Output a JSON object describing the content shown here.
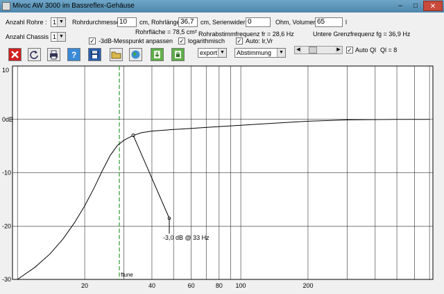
{
  "window": {
    "title": "Mivoc AW 3000 im Bassreflex-Gehäuse",
    "min": "–",
    "max": "□",
    "close": "✕"
  },
  "row1": {
    "anzahl_rohre_label": "Anzahl Rohre :",
    "anzahl_rohre_value": "1",
    "rohrdurchmesser_label": "Rohrdurchmesser",
    "rohrdurchmesser_value": "10",
    "rohrlaenge_label": "cm, Rohrlänge",
    "rohrlaenge_value": "36,7",
    "serienwiderstand_label": "cm, Serienwiderstand",
    "serienwiderstand_value": "0",
    "volumen_label": "Ohm, Volumen",
    "volumen_value": "65",
    "volumen_unit": "l"
  },
  "row2": {
    "rohrflaeche": "Rohrfläche = 78,5 cm²",
    "abstimmfrequenz": "Rohrabstimmfrequenz fr = 28,6 Hz",
    "grenzfrequenz": "Untere Grenzfrequenz fg = 36,9 Hz",
    "anzahl_chassis_label": "Anzahl Chassis :",
    "anzahl_chassis_value": "1",
    "messpunkt_label": "-3dB-Messpunkt anpassen",
    "logarithmisch_label": "logarithmisch",
    "auto_lr_label": "Auto: lr,Vr"
  },
  "toolbar": {
    "export_value": "export",
    "abstimmung_value": "Abstimmung",
    "auto_ql_label": "Auto Ql",
    "ql_value": "Ql = 8"
  },
  "colors": {
    "curve": "#000000",
    "marker": "#2f9a2f",
    "grid": "#000000"
  },
  "chart_data": {
    "type": "line",
    "title": "",
    "xlabel": "",
    "ylabel": "",
    "x_scale": "log",
    "x_ticks": [
      20,
      40,
      60,
      80,
      100,
      200
    ],
    "y_ticks": [
      "10",
      "0dB",
      "-10",
      "-20",
      "-30"
    ],
    "y_tick_values": [
      10,
      0,
      -10,
      -20,
      -30
    ],
    "ylim": [
      -30,
      10
    ],
    "grid": true,
    "marker_line": {
      "x": 28.6,
      "label": "ftune"
    },
    "annotation": {
      "text": "-3,0 dB @  33 Hz",
      "x": 33,
      "y": -3
    },
    "series": [
      {
        "x": [
          10,
          12,
          14,
          16,
          18,
          20,
          22,
          24,
          26,
          28,
          30,
          33,
          36,
          40,
          50,
          60,
          80,
          100,
          150,
          200,
          300,
          500,
          700
        ],
        "y": [
          -30,
          -27.7,
          -25.2,
          -22.4,
          -19.4,
          -16.2,
          -12.9,
          -9.6,
          -6.8,
          -4.9,
          -3.9,
          -3.0,
          -2.5,
          -2.2,
          -1.9,
          -1.7,
          -1.35,
          -1.1,
          -0.65,
          -0.35,
          -0.1,
          0,
          0
        ]
      }
    ]
  }
}
